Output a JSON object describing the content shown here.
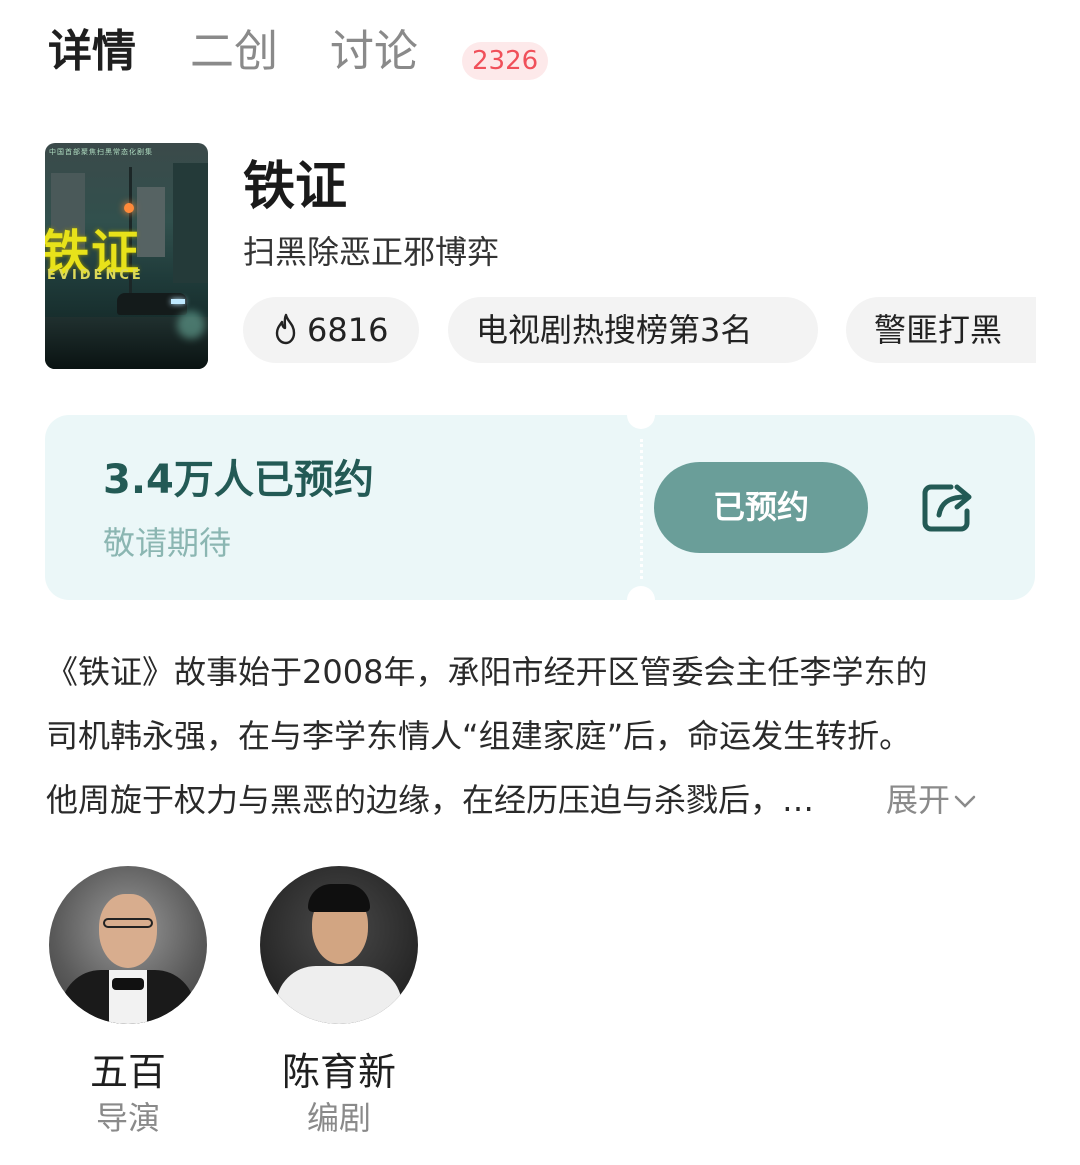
{
  "tabs": [
    {
      "label": "详情",
      "active": true
    },
    {
      "label": "二创",
      "active": false
    },
    {
      "label": "讨论",
      "active": false,
      "badge": "2326"
    }
  ],
  "poster": {
    "title_text": "铁证",
    "subtitle_text": "EVIDENCE",
    "tagline_text": "中国首部聚焦扫黑常态化剧集"
  },
  "show": {
    "title": "铁证",
    "subtitle": "扫黑除恶正邪博弈",
    "chips": [
      {
        "icon": "fire-icon",
        "label": "6816"
      },
      {
        "label": "电视剧热搜榜第3名"
      },
      {
        "label": "警匪打黑"
      }
    ]
  },
  "reservation": {
    "count_text": "3.4万人已预约",
    "hint": "敬请期待",
    "button_label": "已预约",
    "share_icon": "share-icon"
  },
  "synopsis": {
    "lines": [
      "《铁证》故事始于2008年，承阳市经开区管委会主任李学东的",
      "司机韩永强，在与李学东情人“组建家庭”后，命运发生转折。",
      "他周旋于权力与黑恶的边缘，在经历压迫与杀戮后，…"
    ],
    "expand_label": "展开"
  },
  "crew": [
    {
      "name": "五百",
      "role": "导演"
    },
    {
      "name": "陈育新",
      "role": "编剧"
    }
  ],
  "colors": {
    "accent": "#6a9e99",
    "card_bg": "#ebf7f8",
    "count_text": "#235a55",
    "badge_text": "#f0505a"
  }
}
